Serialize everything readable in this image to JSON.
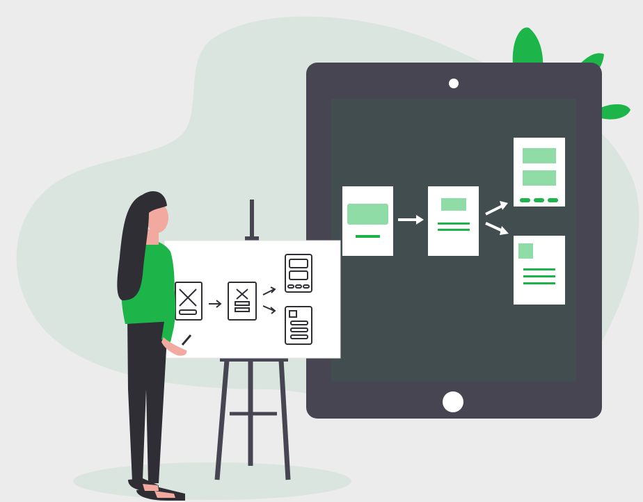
{
  "illustration": {
    "subject": "woman-presenting-wireframe-flow",
    "colors": {
      "background": "#ececec",
      "blob": "#dbe5df",
      "tablet_frame": "#474552",
      "tablet_screen": "#414d4f",
      "accent_green": "#1db44a",
      "light_green": "#8fdca7",
      "card": "#ffffff",
      "skin": "#f2a9a0",
      "hair": "#2f2e35",
      "pants": "#2f2e35",
      "easel": "#474552"
    },
    "icons": [
      "tablet-icon",
      "easel-icon",
      "plant-leaf-icon",
      "arrow-right-icon",
      "wireframe-card-icon"
    ]
  }
}
